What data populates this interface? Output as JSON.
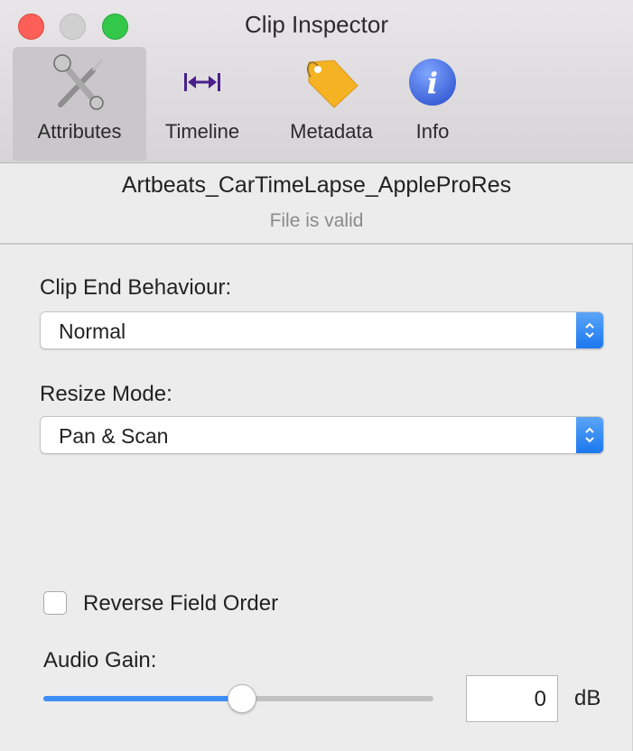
{
  "window": {
    "title": "Clip Inspector"
  },
  "toolbar": {
    "tabs": [
      {
        "label": "Attributes",
        "icon": "wrench-screwdriver-icon",
        "selected": true
      },
      {
        "label": "Timeline",
        "icon": "horizontal-arrows-icon",
        "selected": false
      },
      {
        "label": "Metadata",
        "icon": "tag-icon",
        "selected": false
      },
      {
        "label": "Info",
        "icon": "info-icon",
        "selected": false
      }
    ]
  },
  "file": {
    "name": "Artbeats_CarTimeLapse_AppleProRes",
    "status": "File is valid"
  },
  "form": {
    "clip_end_label": "Clip End Behaviour:",
    "clip_end_value": "Normal",
    "resize_label": "Resize Mode:",
    "resize_value": "Pan & Scan",
    "reverse_field_label": "Reverse Field Order",
    "reverse_field_checked": false,
    "audio_gain_label": "Audio Gain:",
    "audio_gain_value": "0",
    "audio_gain_unit": "dB",
    "audio_gain_slider_fraction": 0.51
  },
  "colors": {
    "accent": "#3d8ef8",
    "close": "#fc5f57",
    "maximize": "#34c84a",
    "info_icon": "#4a73e8",
    "tag_icon": "#f5b323",
    "timeline_icon": "#4a1f8c"
  }
}
